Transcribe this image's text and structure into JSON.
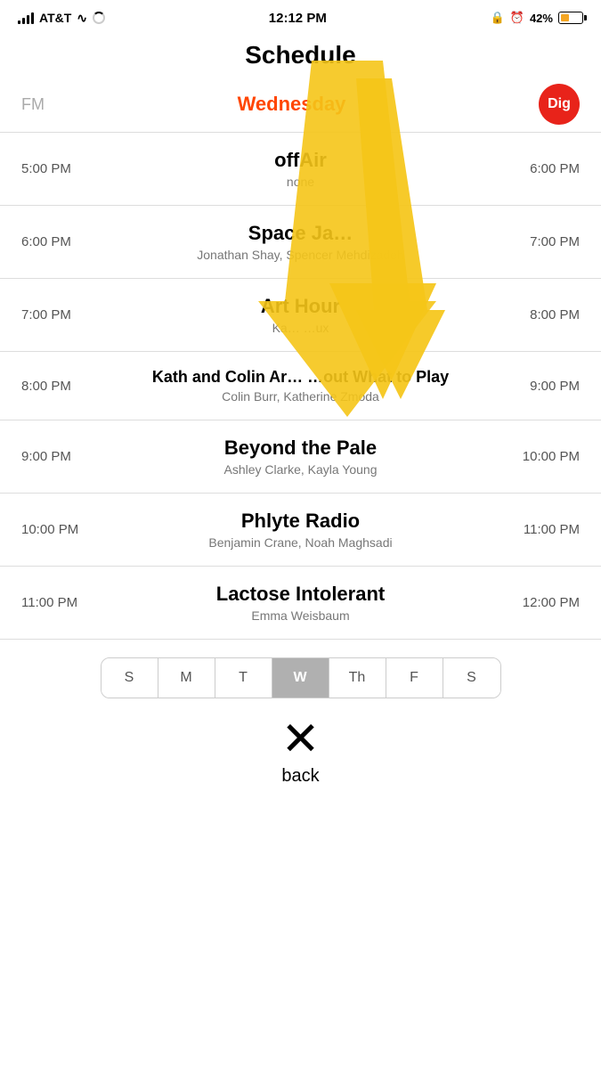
{
  "statusBar": {
    "carrier": "AT&T",
    "time": "12:12 PM",
    "battery": "42%"
  },
  "header": {
    "title": "Schedule",
    "tabFm": "FM",
    "tabDay": "Wednesday",
    "digLabel": "Dig"
  },
  "schedule": [
    {
      "timeStart": "5:00 PM",
      "timeEnd": "6:00 PM",
      "title": "offAir",
      "hosts": "none"
    },
    {
      "timeStart": "6:00 PM",
      "timeEnd": "7:00 PM",
      "title": "Space Ja…",
      "hosts": "Jonathan Shay, Spencer Mehdizadeh"
    },
    {
      "timeStart": "7:00 PM",
      "timeEnd": "8:00 PM",
      "title": "Art Hour",
      "hosts": "Kat… …ux"
    },
    {
      "timeStart": "8:00 PM",
      "timeEnd": "9:00 PM",
      "title": "Kath and Colin Ar… …out What to Play",
      "hosts": "Colin Burr, Katherine Zmoda"
    },
    {
      "timeStart": "9:00 PM",
      "timeEnd": "10:00 PM",
      "title": "Beyond the Pale",
      "hosts": "Ashley Clarke, Kayla Young"
    },
    {
      "timeStart": "10:00 PM",
      "timeEnd": "11:00 PM",
      "title": "Phlyte Radio",
      "hosts": "Benjamin Crane, Noah Maghsadi"
    },
    {
      "timeStart": "11:00 PM",
      "timeEnd": "12:00 PM",
      "title": "Lactose Intolerant",
      "hosts": "Emma Weisbaum"
    }
  ],
  "days": [
    {
      "label": "S",
      "key": "sun",
      "active": false
    },
    {
      "label": "M",
      "key": "mon",
      "active": false
    },
    {
      "label": "T",
      "key": "tue",
      "active": false
    },
    {
      "label": "W",
      "key": "wed",
      "active": true
    },
    {
      "label": "Th",
      "key": "thu",
      "active": false
    },
    {
      "label": "F",
      "key": "fri",
      "active": false
    },
    {
      "label": "S",
      "key": "sat",
      "active": false
    }
  ],
  "backButton": {
    "symbol": "✕",
    "label": "back"
  }
}
